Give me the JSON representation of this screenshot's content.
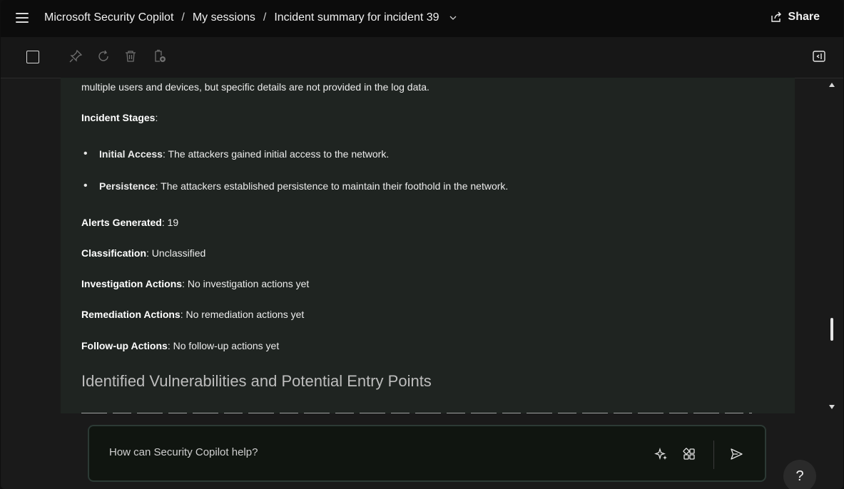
{
  "header": {
    "app_title": "Microsoft Security Copilot",
    "sep1": "/",
    "sessions": "My sessions",
    "sep2": "/",
    "session_title": "Incident summary for incident 39",
    "share_label": "Share"
  },
  "toolbar": {
    "icons": [
      "checkbox-icon",
      "pin-icon",
      "refresh-icon",
      "delete-icon",
      "add-to-pinboard-icon",
      "panel-toggle-icon"
    ]
  },
  "content": {
    "top_line": "multiple users and devices, but specific details are not provided in the log data.",
    "stages_label": "Incident Stages",
    "stages_colon": ":",
    "stages": [
      {
        "label": "Initial Access",
        "text": ": The attackers gained initial access to the network."
      },
      {
        "label": "Persistence",
        "text": ": The attackers established persistence to maintain their foothold in the network."
      }
    ],
    "alerts_label": "Alerts Generated",
    "alerts_value": ": 19",
    "classification_label": "Classification",
    "classification_value": ": Unclassified",
    "investigation_label": "Investigation Actions",
    "investigation_value": ": No investigation actions yet",
    "remediation_label": "Remediation Actions",
    "remediation_value": ": No remediation actions yet",
    "followup_label": "Follow-up Actions",
    "followup_value": ": No follow-up actions yet",
    "section_heading": "Identified Vulnerabilities and Potential Entry Points"
  },
  "prompt": {
    "placeholder": "How can Security Copilot help?"
  },
  "help_label": "?",
  "colors": {
    "background": "#1a1a1a",
    "content_bg": "#1f2421",
    "prompt_border": "#2c3a35"
  }
}
